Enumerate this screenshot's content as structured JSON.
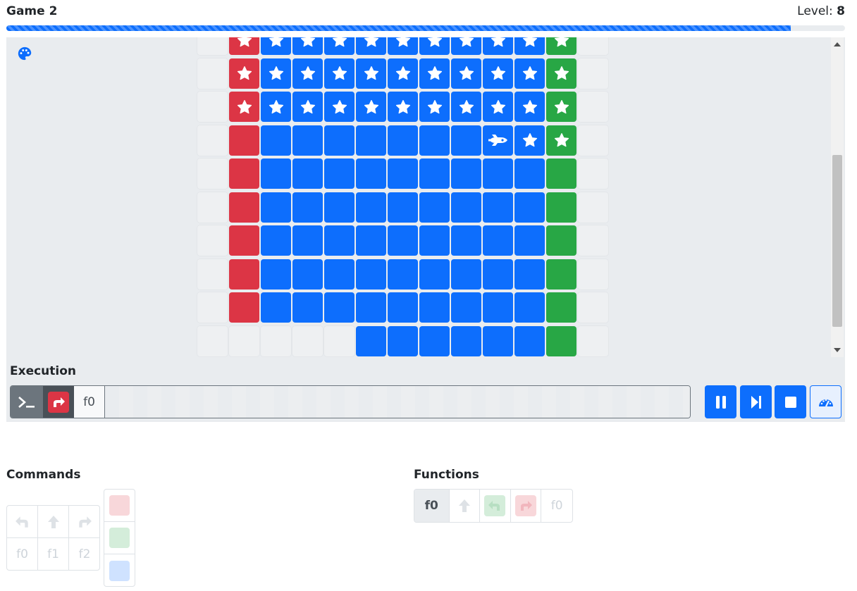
{
  "header": {
    "title": "Game 2",
    "level_label": "Level:",
    "level_value": "8"
  },
  "progress": {
    "fraction": 0.935,
    "color": "#0d6efd"
  },
  "colors": {
    "red": "#dc3545",
    "blue": "#0d6efd",
    "green": "#28a745",
    "empty": "#eef0f2"
  },
  "board": {
    "legend": {
      "e": "empty",
      "R": "red",
      "B": "blue",
      "G": "green",
      "*": "star",
      "S": "ship"
    },
    "rows": [
      [
        "e",
        "R*",
        "B*",
        "B*",
        "B*",
        "B*",
        "B*",
        "B*",
        "B*",
        "B*",
        "B*",
        "G*",
        "e"
      ],
      [
        "e",
        "R*",
        "B*",
        "B*",
        "B*",
        "B*",
        "B*",
        "B*",
        "B*",
        "B*",
        "B*",
        "G*",
        "e"
      ],
      [
        "e",
        "R*",
        "B*",
        "B*",
        "B*",
        "B*",
        "B*",
        "B*",
        "B*",
        "B*",
        "B*",
        "G*",
        "e"
      ],
      [
        "e",
        "R",
        "B",
        "B",
        "B",
        "B",
        "B",
        "B",
        "B",
        "BS",
        "B*",
        "G*",
        "e"
      ],
      [
        "e",
        "R",
        "B",
        "B",
        "B",
        "B",
        "B",
        "B",
        "B",
        "B",
        "B",
        "G",
        "e"
      ],
      [
        "e",
        "R",
        "B",
        "B",
        "B",
        "B",
        "B",
        "B",
        "B",
        "B",
        "B",
        "G",
        "e"
      ],
      [
        "e",
        "R",
        "B",
        "B",
        "B",
        "B",
        "B",
        "B",
        "B",
        "B",
        "B",
        "G",
        "e"
      ],
      [
        "e",
        "R",
        "B",
        "B",
        "B",
        "B",
        "B",
        "B",
        "B",
        "B",
        "B",
        "G",
        "e"
      ],
      [
        "e",
        "R",
        "B",
        "B",
        "B",
        "B",
        "B",
        "B",
        "B",
        "B",
        "B",
        "G",
        "e"
      ],
      [
        "e",
        "e",
        "e",
        "e",
        "e",
        "B",
        "B",
        "B",
        "B",
        "B",
        "B",
        "G",
        "e"
      ],
      [
        "e",
        "e",
        "e",
        "e",
        "e",
        "e",
        "e",
        "e",
        "e",
        "e",
        "e",
        "e",
        "e"
      ]
    ]
  },
  "execution": {
    "label": "Execution",
    "steps": [
      {
        "kind": "terminal",
        "icon": "terminal-icon"
      },
      {
        "kind": "current",
        "icon": "turn-right-icon",
        "color": "#dc3545"
      },
      {
        "kind": "call",
        "label": "f0"
      }
    ],
    "controls": [
      "pause-icon",
      "step-icon",
      "stop-icon",
      "speed-icon"
    ]
  },
  "commands": {
    "label": "Commands",
    "moves": [
      "turn-left-icon",
      "forward-icon",
      "turn-right-icon"
    ],
    "functions": [
      "f0",
      "f1",
      "f2"
    ],
    "colors": [
      "#f8d7da",
      "#d4edda",
      "#cfe2ff"
    ]
  },
  "functions": {
    "label": "Functions",
    "rows": [
      {
        "name": "f0",
        "slots": [
          {
            "icon": "forward-icon",
            "color": ""
          },
          {
            "icon": "turn-left-icon",
            "color": "#d4edda"
          },
          {
            "icon": "turn-right-icon",
            "color": "#f8d7da"
          },
          {
            "label": "f0",
            "color": ""
          }
        ]
      }
    ]
  }
}
